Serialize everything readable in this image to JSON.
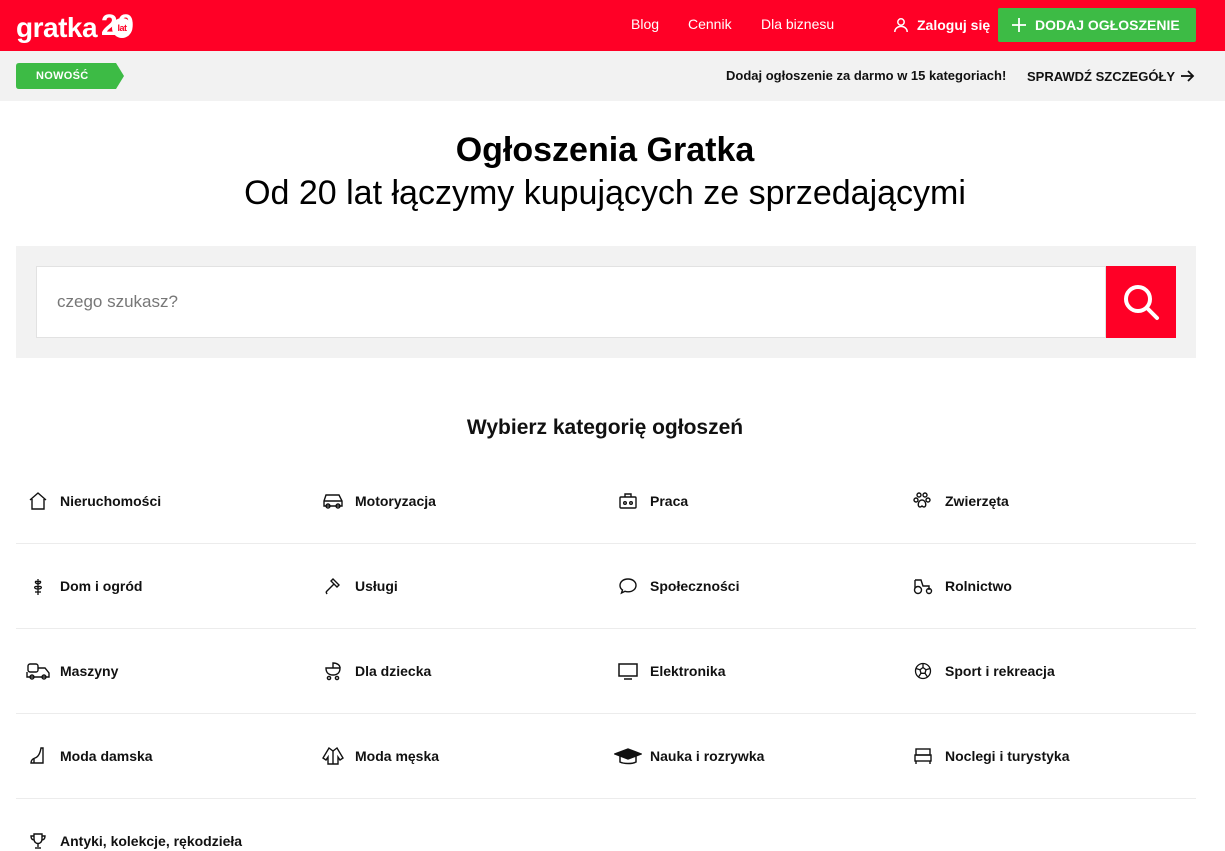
{
  "colors": {
    "brand": "#ff0026",
    "accent_green": "#3dbb45",
    "info_bg": "#f2f2f2"
  },
  "header": {
    "logo": {
      "text": "gratka",
      "anniversary_number": "20",
      "anniversary_unit": "lat"
    },
    "nav": [
      "Blog",
      "Cennik",
      "Dla biznesu"
    ],
    "login_label": "Zaloguj się",
    "login_icon": "user-icon",
    "add_button_label": "DODAJ OGŁOSZENIE",
    "add_button_icon": "plus-icon"
  },
  "info_bar": {
    "badge": "NOWOŚĆ",
    "text": "Dodaj ogłoszenie za darmo w 15 kategoriach!",
    "link_label": "SPRAWDŹ SZCZEGÓŁY",
    "link_icon": "arrow-right-icon"
  },
  "hero": {
    "title": "Ogłoszenia Gratka",
    "subtitle": "Od 20 lat łączymy kupujących ze sprzedającymi"
  },
  "search": {
    "placeholder": "czego szukasz?",
    "value": "",
    "button_icon": "search-icon"
  },
  "categories": {
    "heading": "Wybierz kategorię ogłoszeń",
    "items": [
      {
        "label": "Nieruchomości",
        "icon": "house-icon"
      },
      {
        "label": "Motoryzacja",
        "icon": "car-icon"
      },
      {
        "label": "Praca",
        "icon": "briefcase-icon"
      },
      {
        "label": "Zwierzęta",
        "icon": "paw-icon"
      },
      {
        "label": "Dom i ogród",
        "icon": "plant-icon"
      },
      {
        "label": "Usługi",
        "icon": "hammer-icon"
      },
      {
        "label": "Społeczności",
        "icon": "chat-bubble-icon"
      },
      {
        "label": "Rolnictwo",
        "icon": "tractor-icon"
      },
      {
        "label": "Maszyny",
        "icon": "machine-icon"
      },
      {
        "label": "Dla dziecka",
        "icon": "stroller-icon"
      },
      {
        "label": "Elektronika",
        "icon": "monitor-icon"
      },
      {
        "label": "Sport i rekreacja",
        "icon": "ball-icon"
      },
      {
        "label": "Moda damska",
        "icon": "high-heel-icon"
      },
      {
        "label": "Moda męska",
        "icon": "shirt-icon"
      },
      {
        "label": "Nauka i rozrywka",
        "icon": "graduation-cap-icon"
      },
      {
        "label": "Noclegi i turystyka",
        "icon": "bed-icon"
      },
      {
        "label": "Antyki, kolekcje, rękodzieła",
        "icon": "trophy-icon"
      }
    ]
  }
}
